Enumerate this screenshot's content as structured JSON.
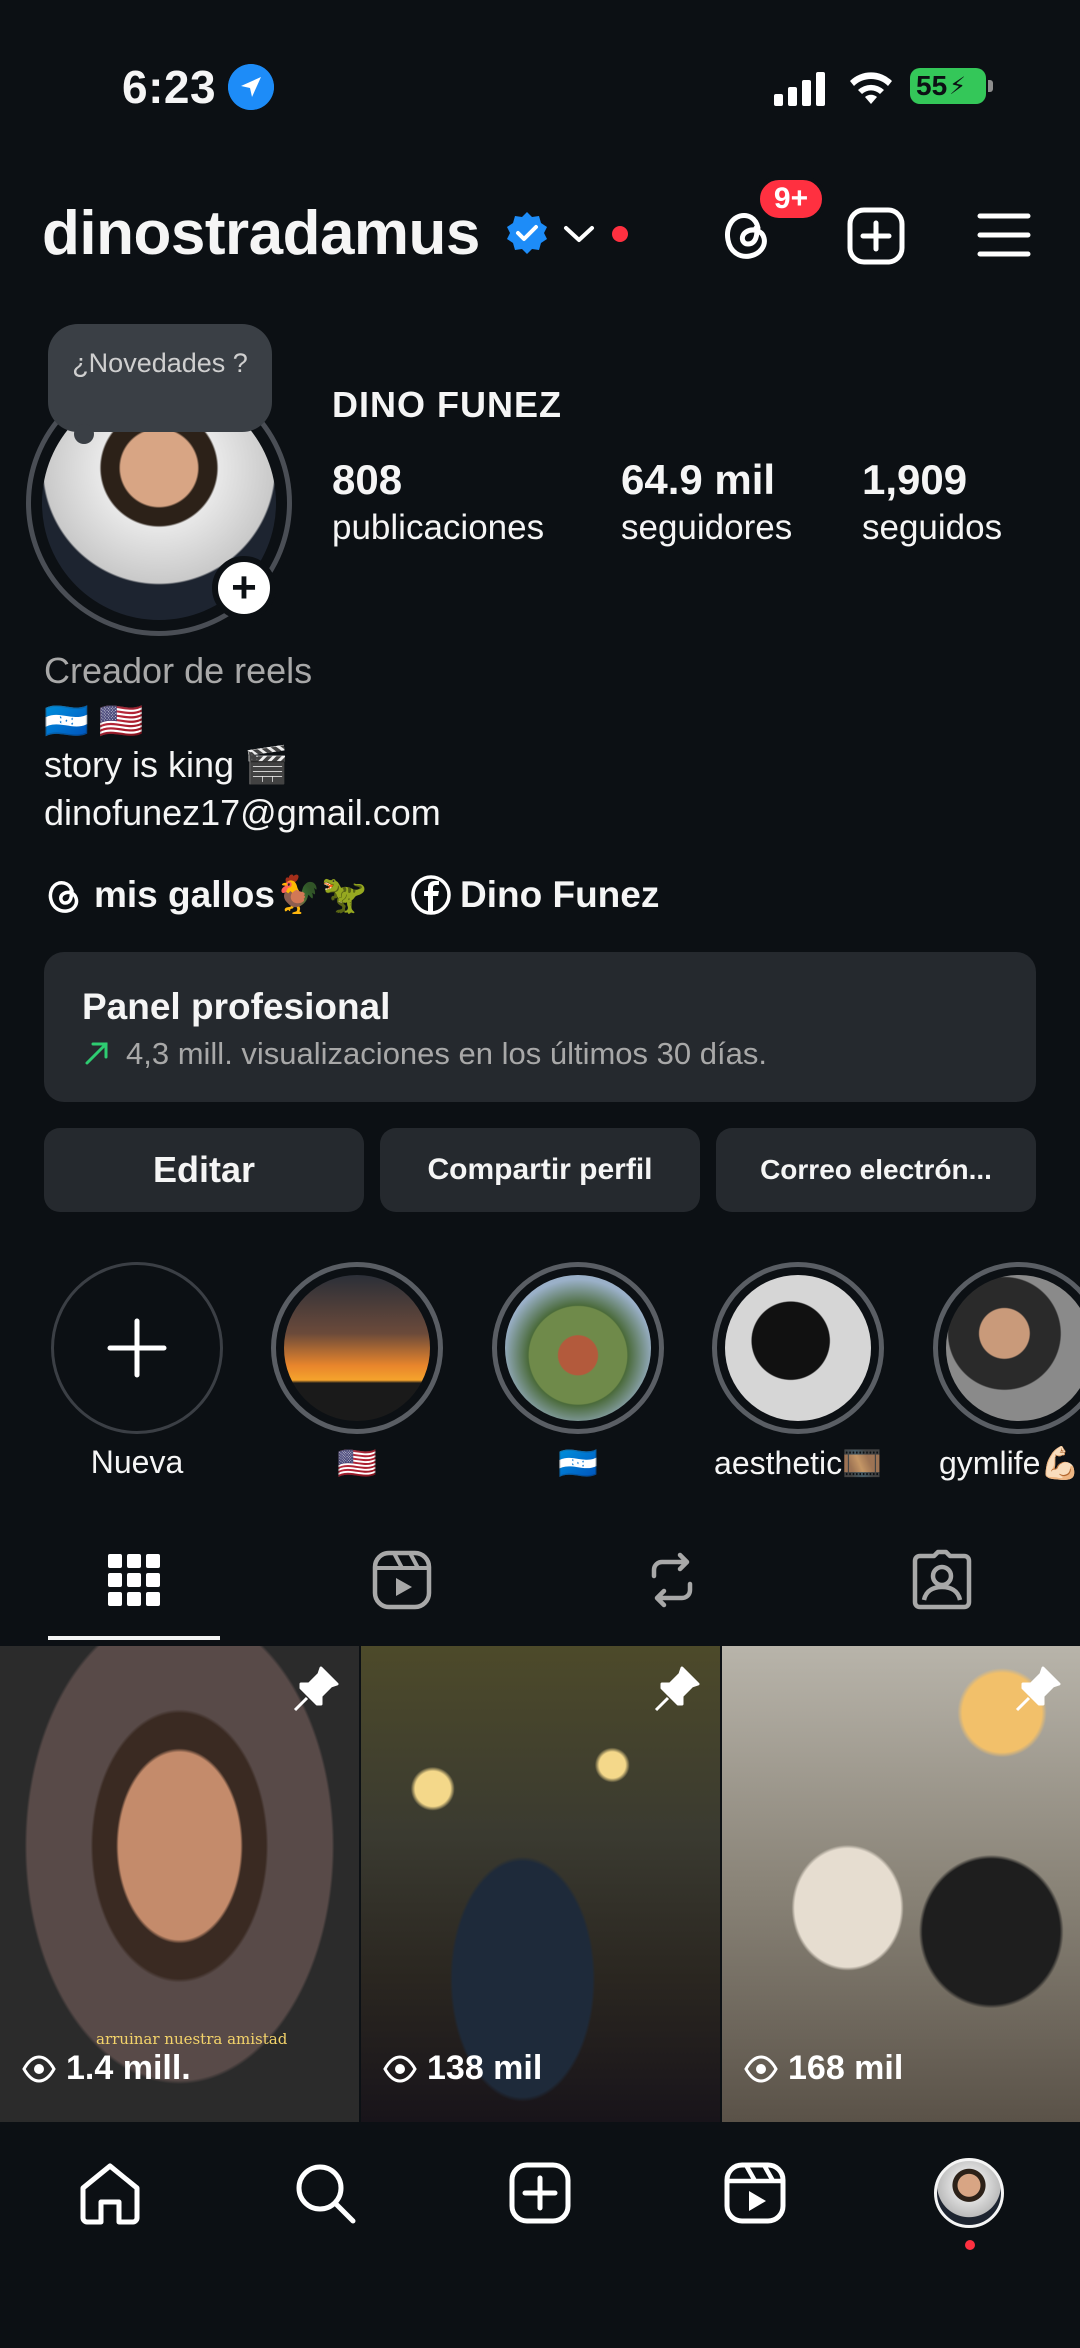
{
  "status_bar": {
    "time": "6:23",
    "battery": "55"
  },
  "header": {
    "username": "dinostradamus",
    "threads_badge": "9+"
  },
  "profile": {
    "note": "¿Novedades ?",
    "full_name": "DINO FUNEZ",
    "stats": [
      {
        "value": "808",
        "label": "publicaciones"
      },
      {
        "value": "64.9 mil",
        "label": "seguidores"
      },
      {
        "value": "1,909",
        "label": "seguidos"
      }
    ],
    "category": "Creador de reels",
    "flags": "🇭🇳 🇺🇸",
    "bio_lines": [
      "story is king 🎬",
      "dinofunez17@gmail.com"
    ],
    "links": [
      {
        "label": "mis gallos🐓🦖",
        "icon": "threads-icon"
      },
      {
        "label": "Dino Funez",
        "icon": "facebook-icon"
      }
    ]
  },
  "panel": {
    "title": "Panel profesional",
    "subtitle": "4,3 mill. visualizaciones en los últimos 30 días.",
    "accent": "#2ecc71"
  },
  "buttons": [
    "Editar",
    "Compartir perfil",
    "Correo electrón..."
  ],
  "highlights": [
    {
      "label": "Nueva"
    },
    {
      "label": "🇺🇸"
    },
    {
      "label": "🇭🇳"
    },
    {
      "label": "aesthetic🎞️"
    },
    {
      "label": "gymlife💪🏻"
    }
  ],
  "tabs": [
    "grid-icon",
    "reels-icon",
    "reposts-icon",
    "tagged-icon"
  ],
  "grid": [
    {
      "views": "1.4 mill.",
      "caption": "arruinar nuestra amistad",
      "pinned": true
    },
    {
      "views": "138 mil",
      "pinned": true
    },
    {
      "views": "168 mil",
      "pinned": true
    }
  ],
  "bottom_nav": [
    "home-icon",
    "search-icon",
    "create-icon",
    "reels-icon",
    "profile-avatar"
  ],
  "colors": {
    "background": "#0c1014",
    "surface": "#25292e",
    "verified": "#1d8cf8",
    "notification": "#ff3040"
  }
}
